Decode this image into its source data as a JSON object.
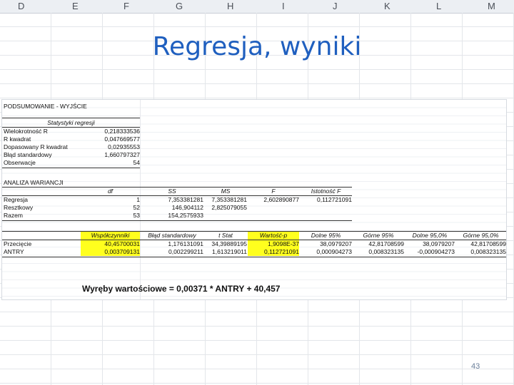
{
  "column_headers": [
    "D",
    "E",
    "F",
    "G",
    "H",
    "I",
    "J",
    "K",
    "L",
    "M"
  ],
  "title": "Regresja, wyniki",
  "sheet": {
    "summary_header": "PODSUMOWANIE - WYJŚCIE",
    "reg_stats_title": "Statystyki regresji",
    "reg_stats": [
      {
        "label": "Wielokrotność R",
        "value": "0,218333536"
      },
      {
        "label": "R kwadrat",
        "value": "0,047669577"
      },
      {
        "label": "Dopasowany R kwadrat",
        "value": "0,02935553"
      },
      {
        "label": "Błąd standardowy",
        "value": "1,660797327"
      },
      {
        "label": "Obserwacje",
        "value": "54"
      }
    ],
    "anova_title": "ANALIZA WARIANCJI",
    "anova_headers": [
      "df",
      "SS",
      "MS",
      "F",
      "Istotność F"
    ],
    "anova_rows": [
      {
        "label": "Regresja",
        "df": "1",
        "ss": "7,353381281",
        "ms": "7,353381281",
        "f": "2,602890877",
        "sig": "0,112721091"
      },
      {
        "label": "Resztkowy",
        "df": "52",
        "ss": "146,904112",
        "ms": "2,825079055",
        "f": "",
        "sig": ""
      },
      {
        "label": "Razem",
        "df": "53",
        "ss": "154,2575933",
        "ms": "",
        "f": "",
        "sig": ""
      }
    ],
    "coef_headers": [
      "Współczynniki",
      "Błąd standardowy",
      "t Stat",
      "Wartość-p",
      "Dolne 95%",
      "Górne 95%",
      "Dolne 95,0%",
      "Górne 95,0%"
    ],
    "coef_rows": [
      {
        "label": "Przecięcie",
        "values": [
          "40,45700031",
          "1,176131091",
          "34,39889195",
          "1,9098E-37",
          "38,0979207",
          "42,81708599",
          "38,0979207",
          "42,81708599"
        ]
      },
      {
        "label": "ANTRY",
        "values": [
          "0,003709131",
          "0,002299211",
          "1,613219011",
          "0,112721091",
          "0,000904273",
          "0,008323135",
          "-0,000904273",
          "0,008323135"
        ]
      }
    ],
    "equation": "Wyręby wartościowe  = 0,00371 * ANTRY + 40,457"
  },
  "page_number": "43"
}
